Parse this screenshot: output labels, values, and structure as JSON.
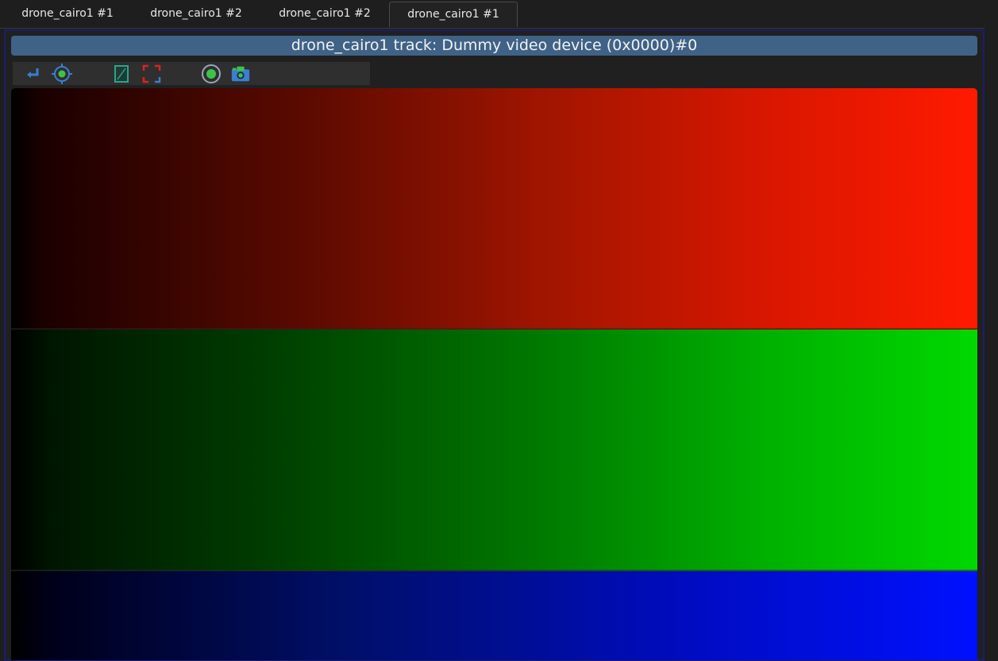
{
  "tabs": [
    {
      "label": "drone_cairo1 #1"
    },
    {
      "label": "drone_cairo1 #2"
    },
    {
      "label": "drone_cairo1 #2"
    },
    {
      "label": "drone_cairo1 #1",
      "active": true
    }
  ],
  "panel": {
    "title": "drone_cairo1 track: Dummy video device (0x0000)#0"
  },
  "toolbar": {
    "icons": [
      "return-icon",
      "target-icon",
      "image-crop-icon",
      "fullscreen-icon",
      "record-icon",
      "camera-icon"
    ]
  },
  "video": {
    "bands": [
      "red",
      "green",
      "blue"
    ]
  },
  "colors": {
    "title_bg": "#3f6286",
    "panel_border": "#1c1c6e",
    "icon_blue": "#3a7fd0",
    "icon_green": "#3cc44a",
    "icon_red": "#e02020"
  }
}
